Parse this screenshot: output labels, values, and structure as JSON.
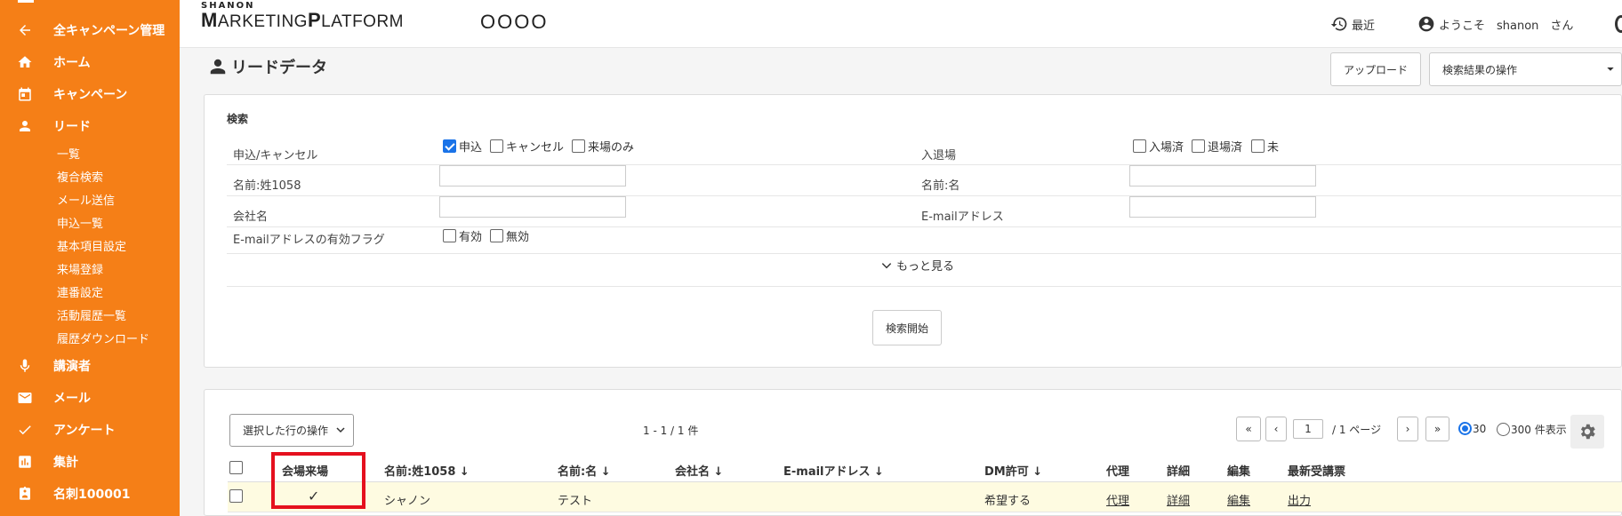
{
  "sidebar": {
    "back_label": "全キャンペーン管理",
    "items": [
      {
        "label": "ホーム",
        "icon": "home-icon"
      },
      {
        "label": "キャンペーン",
        "icon": "calendar-icon"
      },
      {
        "label": "リード",
        "icon": "person-icon"
      }
    ],
    "sub_items": [
      "一覧",
      "複合検索",
      "メール送信",
      "申込一覧",
      "基本項目設定",
      "来場登録",
      "連番設定",
      "活動履歴一覧",
      "履歴ダウンロード"
    ],
    "items2": [
      {
        "label": "講演者",
        "icon": "mic-icon"
      },
      {
        "label": "メール",
        "icon": "mail-icon"
      },
      {
        "label": "アンケート",
        "icon": "check-icon"
      },
      {
        "label": "集計",
        "icon": "chart-icon"
      },
      {
        "label": "名刺100001",
        "icon": "badge-icon"
      }
    ],
    "color": "#f57f17"
  },
  "header": {
    "logo_small": "SHANON",
    "logo_big_1": "M",
    "logo_big_2": "ARKETING",
    "logo_big_3": "P",
    "logo_big_4": "LATFORM",
    "org": "OOOO",
    "recent": "最近",
    "welcome": "ようこそ　shanon　さん"
  },
  "page": {
    "title": "リードデータ",
    "upload": "アップロード",
    "ops_select": "検索結果の操作"
  },
  "search": {
    "title": "検索",
    "apply_label": "申込/キャンセル",
    "apply_opts": [
      {
        "label": "申込",
        "checked": true
      },
      {
        "label": "キャンセル",
        "checked": false
      },
      {
        "label": "来場のみ",
        "checked": false
      }
    ],
    "entry_label": "入退場",
    "entry_opts": [
      "入場済",
      "退場済",
      "未"
    ],
    "last_name_label": "名前:姓1058",
    "first_name_label": "名前:名",
    "company_label": "会社名",
    "email_label": "E-mailアドレス",
    "email_flag_label": "E-mailアドレスの有効フラグ",
    "email_flag_opts": [
      "有効",
      "無効"
    ],
    "more": "もっと見る",
    "submit": "検索開始"
  },
  "results": {
    "row_ops": "選択した行の操作",
    "count": "1 - 1 / 1 件",
    "page_input": "1",
    "page_total": "/ 1 ページ",
    "per_page_30": "30",
    "per_page_300": "300 件表示",
    "columns": [
      "会場来場",
      "名前:姓1058 ↓",
      "名前:名 ↓",
      "会社名 ↓",
      "E-mailアドレス ↓",
      "DM許可 ↓",
      "代理",
      "詳細",
      "編集",
      "最新受講票"
    ],
    "rows": [
      {
        "visit": "✓",
        "last_name": "シャノン",
        "first_name": "テスト",
        "company": "",
        "email": "",
        "dm": "希望する",
        "proxy": "代理",
        "detail": "詳細",
        "edit": "編集",
        "ticket": "出力"
      }
    ]
  }
}
